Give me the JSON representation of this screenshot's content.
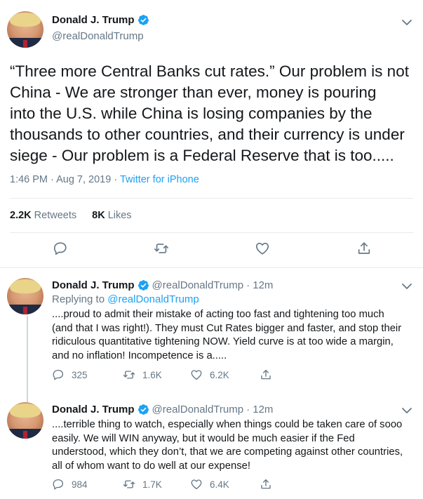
{
  "main_tweet": {
    "name": "Donald J. Trump",
    "handle": "@realDonaldTrump",
    "text": "“Three more Central Banks cut rates.” Our problem is not\nChina - We are stronger than ever, money is pouring\ninto the U.S. while China is losing companies by the\nthousands to other countries, and their currency is under\nsiege - Our problem is a Federal Reserve that is too.....",
    "time": "1:46 PM · Aug 7, 2019 ·",
    "source": "Twitter for iPhone",
    "retweets_count": "2.2K",
    "retweets_label": "Retweets",
    "likes_count": "8K",
    "likes_label": "Likes"
  },
  "replies": [
    {
      "name": "Donald J. Trump",
      "handle": "@realDonaldTrump",
      "time": "· 12m",
      "replying_prefix": "Replying to",
      "replying_handle": "@realDonaldTrump",
      "text": "....proud to admit their mistake of acting too fast and tightening too much\n(and that I was right!). They must Cut Rates bigger and faster, and stop their\nridiculous quantitative tightening NOW. Yield curve is at too wide a margin,\nand no inflation! Incompetence is a.....",
      "reply_count": "325",
      "retweet_count": "1.6K",
      "like_count": "6.2K"
    },
    {
      "name": "Donald J. Trump",
      "handle": "@realDonaldTrump",
      "time": "· 12m",
      "text": "....terrible thing to watch, especially when things could be taken care of sooo\neasily. We will WIN anyway, but it would be much easier if the Fed\nunderstood, which they don’t, that we are competing against other countries,\nall of whom want to do well at our expense!",
      "reply_count": "984",
      "retweet_count": "1.7K",
      "like_count": "6.4K"
    }
  ],
  "icons": {
    "verified": "verified-badge-icon",
    "caret": "chevron-down-icon",
    "reply": "reply-icon",
    "retweet": "retweet-icon",
    "like": "heart-icon",
    "share": "share-icon"
  },
  "colors": {
    "accent": "#1da1f2",
    "text": "#14171a",
    "secondary": "#657786",
    "border": "#e6ecf0"
  }
}
